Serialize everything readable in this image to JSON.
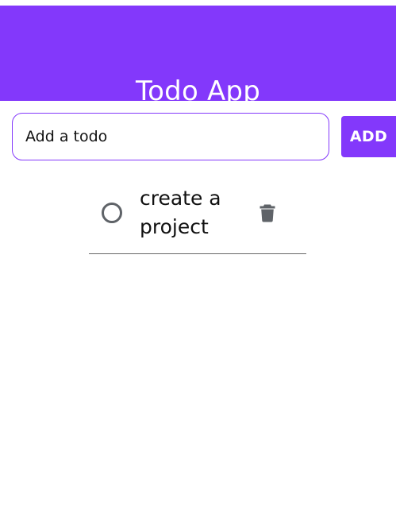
{
  "app": {
    "title": "Todo App",
    "accent_color": "#8338fb"
  },
  "form": {
    "input_value": "",
    "input_placeholder": "Add a todo",
    "add_label": "ADD"
  },
  "todos": [
    {
      "text": "create a project",
      "completed": false,
      "toggle_icon": "circle-outline-icon",
      "delete_icon": "trash-icon"
    }
  ]
}
